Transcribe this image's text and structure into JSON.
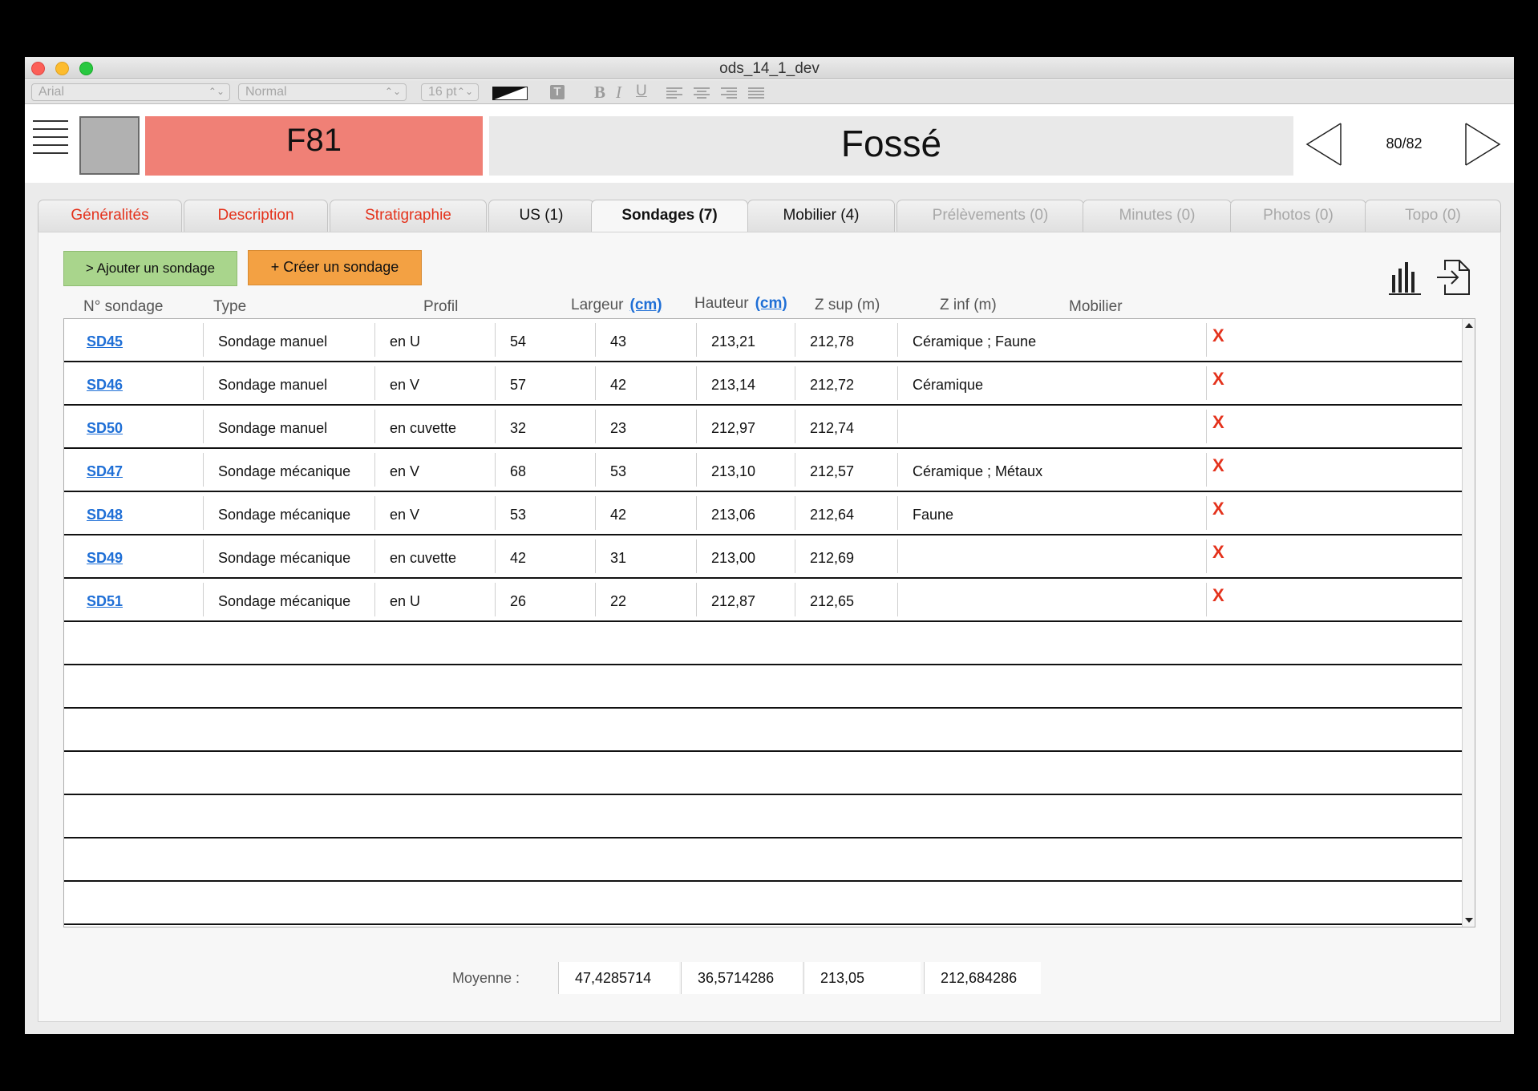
{
  "window": {
    "title": "ods_14_1_dev"
  },
  "format_bar": {
    "font": "Arial",
    "style": "Normal",
    "size": "16 pt",
    "bold": "B",
    "italic": "I",
    "underline": "U",
    "text_icon": "T"
  },
  "header": {
    "code": "F81",
    "kind": "Fossé",
    "counter": "80/82",
    "code_color": "#f08076"
  },
  "tabs": [
    {
      "label": "Généralités"
    },
    {
      "label": "Description"
    },
    {
      "label": "Stratigraphie"
    },
    {
      "label": "US (1)"
    },
    {
      "label": "Sondages (7)"
    },
    {
      "label": "Mobilier (4)"
    },
    {
      "label": "Prélèvements (0)"
    },
    {
      "label": "Minutes (0)"
    },
    {
      "label": "Photos (0)"
    },
    {
      "label": "Topo (0)"
    }
  ],
  "actions": {
    "add": "> Ajouter un sondage",
    "create": "+ Créer un sondage"
  },
  "columns": {
    "num": "N° sondage",
    "type": "Type",
    "profil": "Profil",
    "largeur": "Largeur",
    "hauteur": "Hauteur",
    "unit": "(cm)",
    "zsup": "Z sup (m)",
    "zinf": "Z inf (m)",
    "mobilier": "Mobilier"
  },
  "rows": [
    {
      "id": "SD45",
      "type": "Sondage manuel",
      "profil": "en U",
      "largeur": "54",
      "hauteur": "43",
      "zsup": "213,21",
      "zinf": "212,78",
      "mobilier": "Céramique ; Faune",
      "delete": "X"
    },
    {
      "id": "SD46",
      "type": "Sondage manuel",
      "profil": "en V",
      "largeur": "57",
      "hauteur": "42",
      "zsup": "213,14",
      "zinf": "212,72",
      "mobilier": "Céramique",
      "delete": "X"
    },
    {
      "id": "SD50",
      "type": "Sondage manuel",
      "profil": "en cuvette",
      "largeur": "32",
      "hauteur": "23",
      "zsup": "212,97",
      "zinf": "212,74",
      "mobilier": "",
      "delete": "X"
    },
    {
      "id": "SD47",
      "type": "Sondage mécanique",
      "profil": "en V",
      "largeur": "68",
      "hauteur": "53",
      "zsup": "213,10",
      "zinf": "212,57",
      "mobilier": "Céramique ; Métaux",
      "delete": "X"
    },
    {
      "id": "SD48",
      "type": "Sondage mécanique",
      "profil": "en V",
      "largeur": "53",
      "hauteur": "42",
      "zsup": "213,06",
      "zinf": "212,64",
      "mobilier": "Faune",
      "delete": "X"
    },
    {
      "id": "SD49",
      "type": "Sondage mécanique",
      "profil": "en cuvette",
      "largeur": "42",
      "hauteur": "31",
      "zsup": "213,00",
      "zinf": "212,69",
      "mobilier": "",
      "delete": "X"
    },
    {
      "id": "SD51",
      "type": "Sondage mécanique",
      "profil": "en U",
      "largeur": "26",
      "hauteur": "22",
      "zsup": "212,87",
      "zinf": "212,65",
      "mobilier": "",
      "delete": "X"
    }
  ],
  "averages": {
    "label": "Moyenne :",
    "largeur": "47,4285714",
    "hauteur": "36,5714286",
    "zsup": "213,05",
    "zinf": "212,684286"
  }
}
